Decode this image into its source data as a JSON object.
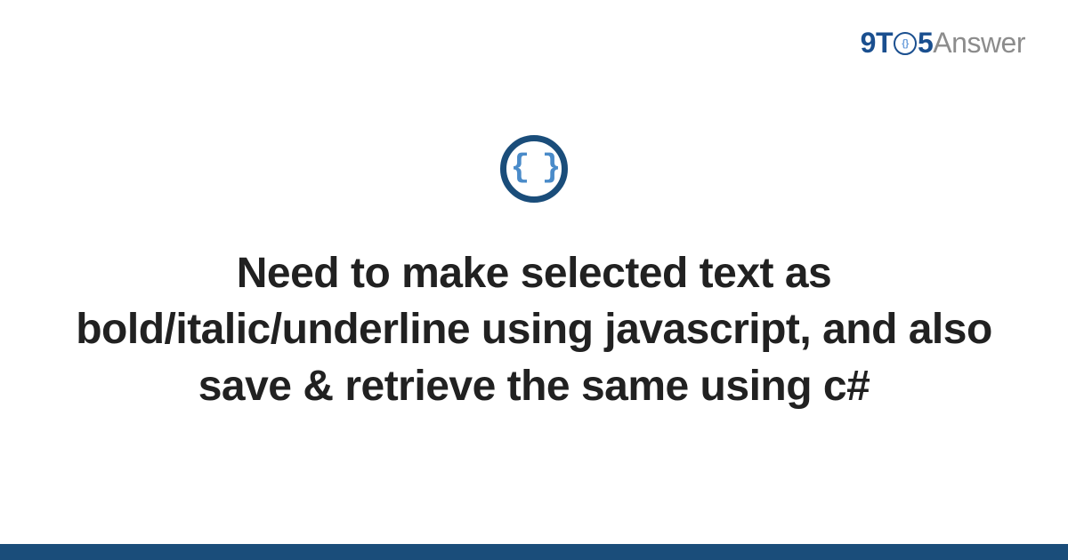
{
  "logo": {
    "part1": "9",
    "part2": "T",
    "innerIcon": "{}",
    "part3": "5",
    "part4": "Answer"
  },
  "icon": {
    "braces": "{ }"
  },
  "title": "Need to make selected text as bold/italic/underline using javascript, and also save & retrieve the same using c#",
  "colors": {
    "brandDark": "#1a4d7a",
    "brandBlue": "#1a4f8f",
    "iconBlue": "#4a8bc9",
    "grayText": "#8c8c8c"
  }
}
